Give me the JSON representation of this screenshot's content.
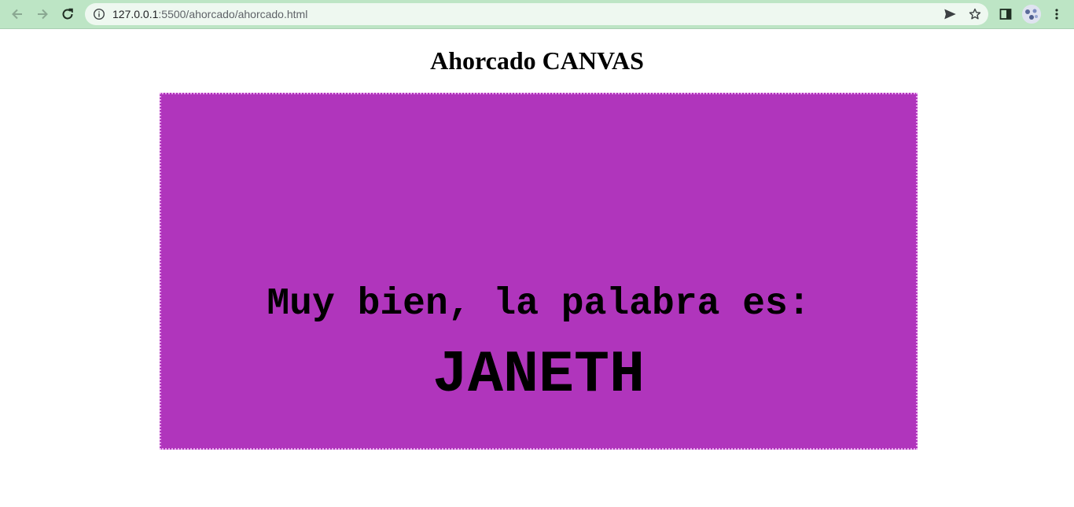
{
  "browser": {
    "url_host": "127.0.0.1",
    "url_rest": ":5500/ahorcado/ahorcado.html",
    "icons": {
      "back": "arrow-left-icon",
      "forward": "arrow-right-icon",
      "reload": "reload-icon",
      "info": "info-icon",
      "share": "send-icon",
      "bookmark": "star-icon",
      "side_panel": "side-panel-icon",
      "menu": "kebab-menu-icon"
    },
    "colors": {
      "toolbar": "#bde5c5",
      "omnibox": "#eef8f0"
    }
  },
  "page": {
    "title": "Ahorcado CANVAS",
    "canvas": {
      "background": "#b035bc",
      "message": "Muy bien, la palabra es:",
      "word": "JANETH"
    }
  }
}
